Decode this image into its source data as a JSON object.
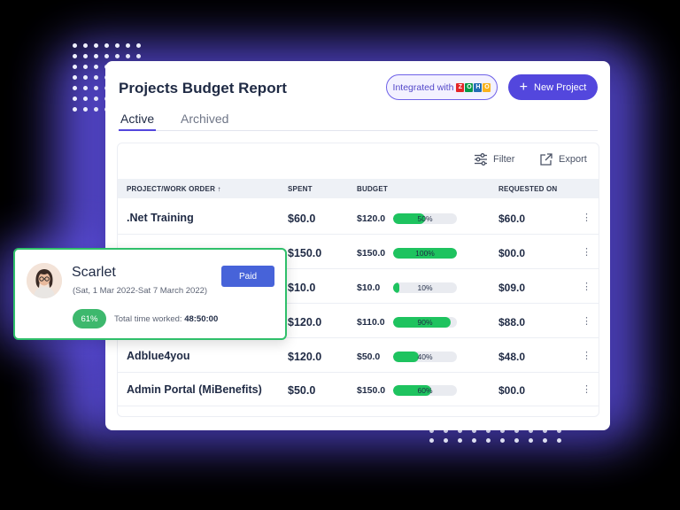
{
  "header": {
    "title": "Projects Budget Report",
    "integrated_label": "Integrated with",
    "zoho_letters": [
      "Z",
      "O",
      "H",
      "O"
    ],
    "new_project_label": "New Project"
  },
  "tabs": [
    {
      "label": "Active",
      "active": true
    },
    {
      "label": "Archived",
      "active": false
    }
  ],
  "toolbar": {
    "filter_label": "Filter",
    "export_label": "Export"
  },
  "table": {
    "columns": [
      "PROJECT/WORK ORDER ↑",
      "SPENT",
      "BUDGET",
      "REQUESTED ON"
    ],
    "rows": [
      {
        "name": ".Net Training",
        "spent": "$60.0",
        "budget": "$120.0",
        "percent_label": "50%",
        "requested": "$60.0"
      },
      {
        "name": "",
        "spent": "$150.0",
        "budget": "$150.0",
        "percent_label": "100%",
        "requested": "$00.0"
      },
      {
        "name": "",
        "spent": "$10.0",
        "budget": "$10.0",
        "percent_label": "10%",
        "requested": "$09.0"
      },
      {
        "name": "",
        "spent": "$120.0",
        "budget": "$110.0",
        "percent_label": "90%",
        "requested": "$88.0"
      },
      {
        "name": "Adblue4you",
        "spent": "$120.0",
        "budget": "$50.0",
        "percent_label": "40%",
        "requested": "$48.0"
      },
      {
        "name": "Admin Portal (MiBenefits)",
        "spent": "$50.0",
        "budget": "$150.0",
        "percent_label": "60%",
        "requested": "$00.0"
      }
    ]
  },
  "popup": {
    "name": "Scarlet",
    "date_range": "(Sat, 1 Mar 2022-Sat 7 March 2022)",
    "status": "Paid",
    "percent": "61%",
    "time_label": "Total time worked:",
    "time_value": "48:50:00"
  },
  "colors": {
    "accent": "#5347dd",
    "progress": "#1ec35f",
    "popup_border": "#2fbf6a",
    "paid_button": "#4763d9"
  }
}
